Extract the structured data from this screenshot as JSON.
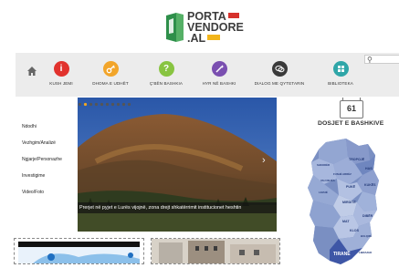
{
  "brand": {
    "logo_line1": "PORTA",
    "logo_line2": "VENDORE",
    "logo_line3": ".AL"
  },
  "search": {
    "placeholder": ""
  },
  "nav": {
    "items": [
      {
        "label": "KUSH JEMI",
        "icon": "info-icon",
        "color": "#e1322d"
      },
      {
        "label": "DHOMA E UDHËT",
        "icon": "key-icon",
        "color": "#f2a52a"
      },
      {
        "label": "Ç'BËN BASHKIA",
        "icon": "question-icon",
        "color": "#88c441"
      },
      {
        "label": "HYR NË BASHKI",
        "icon": "wand-icon",
        "color": "#7a4fb0"
      },
      {
        "label": "DIALOG ME QYTETARIN",
        "icon": "chat-icon",
        "color": "#3a3a3a"
      },
      {
        "label": "BIBLIOTEKA",
        "icon": "grid-icon",
        "color": "#2fa6a8"
      }
    ]
  },
  "left_menu": [
    "Ndodhi",
    "Vezhgim/Analizë",
    "Ngjarje/Personazhe",
    "Investigime",
    "Video/Foto"
  ],
  "slider": {
    "caption": "Prerjet në pyjet e Lurës vijojnë, zona drejt shkatërrimit institucionet heshtin",
    "dots_total": 10,
    "active_dot": 2
  },
  "dosjet": {
    "count": "61",
    "title": "DOSJET E BASHKIVE",
    "map_labels": [
      "TROPOJË",
      "HAS",
      "KUKËS",
      "PUKË",
      "FUSHË ARRËZ",
      "MIRDITË",
      "DIBËR",
      "MAT",
      "KLOS",
      "BULQIZË",
      "TIRANË",
      "LIBRAZHD",
      "LEZHË",
      "VAU DEJËS",
      "SHKODËR"
    ]
  }
}
